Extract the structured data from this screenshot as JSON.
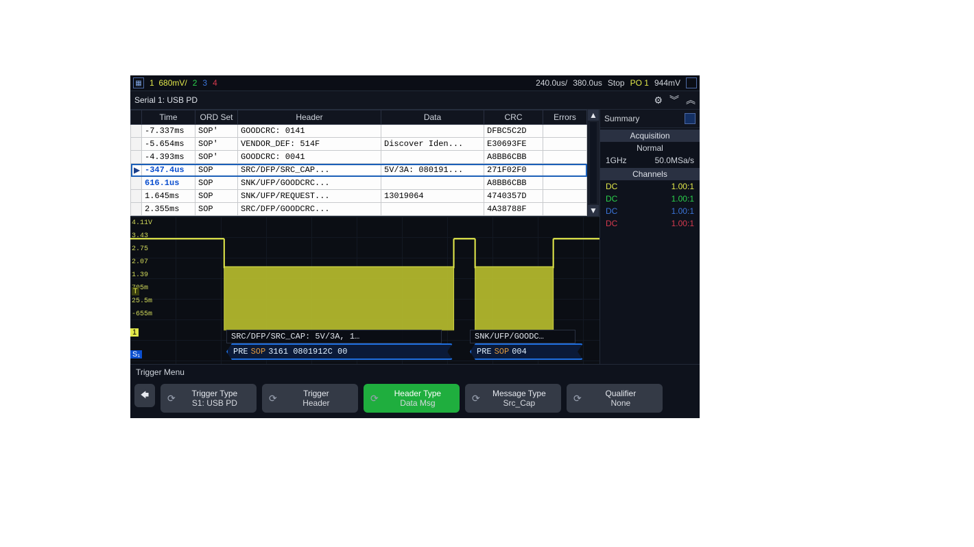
{
  "topbar": {
    "ch1_num": "1",
    "ch1_vdiv": "680mV/",
    "ch2_num": "2",
    "ch3_num": "3",
    "ch4_num": "4",
    "timebase": "240.0us/",
    "delay": "380.0us",
    "run_state": "Stop",
    "po_label": "PO",
    "po_ch": "1",
    "trig_level": "944mV"
  },
  "serial": {
    "title": "Serial 1: USB PD"
  },
  "table": {
    "headers": {
      "time": "Time",
      "ord": "ORD Set",
      "header": "Header",
      "data": "Data",
      "crc": "CRC",
      "errors": "Errors"
    },
    "rows": [
      {
        "mark": "",
        "time": "-7.337ms",
        "ord": "SOP'",
        "header": "GOODCRC: 0141",
        "data": "",
        "crc": "DFBC5C2D",
        "err": ""
      },
      {
        "mark": "",
        "time": "-5.654ms",
        "ord": "SOP'",
        "header": "VENDOR_DEF: 514F",
        "data": "Discover Iden...",
        "crc": "E30693FE",
        "err": ""
      },
      {
        "mark": "",
        "time": "-4.393ms",
        "ord": "SOP'",
        "header": "GOODCRC: 0041",
        "data": "",
        "crc": "A8BB6CBB",
        "err": ""
      },
      {
        "mark": "▶",
        "time": "-347.4us",
        "ord": "SOP",
        "header": "SRC/DFP/SRC_CAP...",
        "data": "5V/3A: 080191...",
        "crc": "271F02F0",
        "err": ""
      },
      {
        "mark": "",
        "time": "616.1us",
        "ord": "SOP",
        "header": "SNK/UFP/GOODCRC...",
        "data": "",
        "crc": "A8BB6CBB",
        "err": ""
      },
      {
        "mark": "",
        "time": "1.645ms",
        "ord": "SOP",
        "header": "SNK/UFP/REQUEST...",
        "data": "13019064",
        "crc": "4740357D",
        "err": ""
      },
      {
        "mark": "",
        "time": "2.355ms",
        "ord": "SOP",
        "header": "SRC/DFP/GOODCRC...",
        "data": "",
        "crc": "4A38788F",
        "err": ""
      }
    ]
  },
  "wave": {
    "ylabels": [
      "4.11V",
      "3.43",
      "2.75",
      "2.07",
      "1.39",
      "705m",
      "25.5m",
      "-655m"
    ],
    "trig_marker": "T",
    "ch_flag": "1",
    "s1_flag": "S₁",
    "decode_labels": {
      "a": "SRC/DFP/SRC_CAP: 5V/3A, 1…",
      "b": "SNK/UFP/GOODC…"
    },
    "decode_segs": {
      "a_pre": "PRE",
      "a_sop": "SOP",
      "a_rest": "3161 0801912C 00",
      "b_pre": "PRE",
      "b_sop": "SOP",
      "b_rest": "004"
    }
  },
  "summary": {
    "title": "Summary",
    "acq_title": "Acquisition",
    "acq_mode": "Normal",
    "acq_bw": "1GHz",
    "acq_rate": "50.0MSa/s",
    "ch_title": "Channels",
    "channels": [
      {
        "cls": "c1",
        "coupling": "DC",
        "probe": "1.00:1"
      },
      {
        "cls": "c2",
        "coupling": "DC",
        "probe": "1.00:1"
      },
      {
        "cls": "c3",
        "coupling": "DC",
        "probe": "1.00:1"
      },
      {
        "cls": "c4",
        "coupling": "DC",
        "probe": "1.00:1"
      }
    ]
  },
  "trigger": {
    "section": "Trigger Menu",
    "back_glyph": "🡄",
    "items": [
      {
        "title": "Trigger Type",
        "sub": "S1: USB PD",
        "green": false
      },
      {
        "title": "Trigger",
        "sub": "Header",
        "green": false
      },
      {
        "title": "Header Type",
        "sub": "Data Msg",
        "green": true
      },
      {
        "title": "Message Type",
        "sub": "Src_Cap",
        "green": false
      },
      {
        "title": "Qualifier",
        "sub": "None",
        "green": false
      }
    ]
  }
}
